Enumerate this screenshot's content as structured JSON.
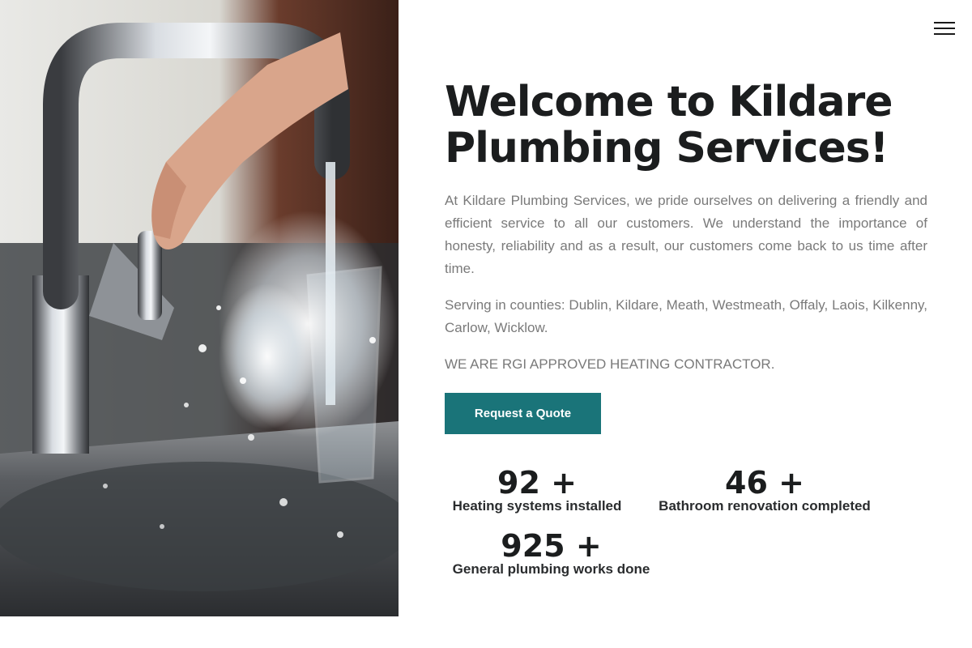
{
  "header": {
    "menu_icon": "hamburger-menu-icon"
  },
  "hero": {
    "image_icon": "kitchen-faucet-photo",
    "title": "Welcome to Kildare Plumbing Services!",
    "intro": "At Kildare Plumbing Services, we pride ourselves on delivering a friendly and efficient service to all our customers. We understand the importance of honesty, reliability and as a result, our customers come back to us time after time.",
    "counties": "Serving in counties: Dublin, Kildare, Meath, Westmeath, Offaly, Laois, Kilkenny, Carlow, Wicklow.",
    "rgi": "WE ARE RGI APPROVED HEATING CONTRACTOR.",
    "cta_label": "Request a Quote"
  },
  "stats": [
    {
      "number": "92 +",
      "label": "Heating systems installed"
    },
    {
      "number": "46 +",
      "label": "Bathroom renovation completed"
    },
    {
      "number": "925 +",
      "label": "General plumbing works done"
    }
  ],
  "colors": {
    "accent": "#1a7479",
    "heading": "#1b1d1e",
    "body_text": "#7a7a7a"
  }
}
